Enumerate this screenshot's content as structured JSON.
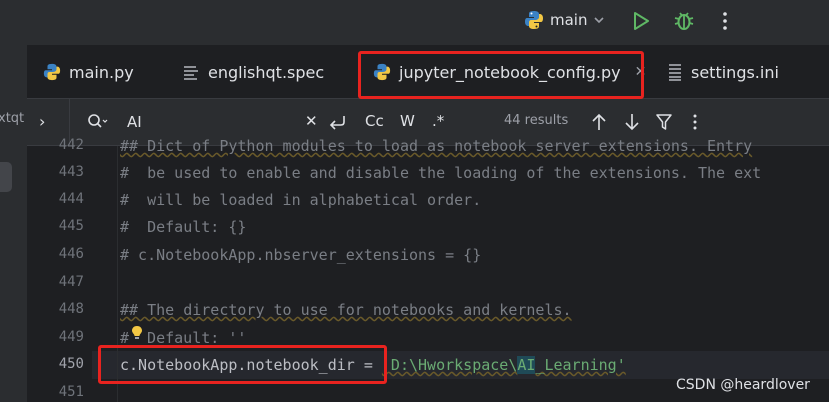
{
  "left_strip": {
    "clipped_label": "xtqt"
  },
  "toolbar": {
    "branch": "main"
  },
  "tabs": [
    {
      "label": "main.py",
      "icon": "python-icon"
    },
    {
      "label": "englishqt.spec",
      "icon": "text-lines-icon"
    },
    {
      "label": "jupyter_notebook_config.py",
      "icon": "python-icon",
      "active": true
    },
    {
      "label": "settings.ini",
      "icon": "ini-file-icon"
    }
  ],
  "search": {
    "query": "AI",
    "match_case_label": "Cc",
    "words_label": "W",
    "regex_label": ".*",
    "results": "44 results"
  },
  "editor": {
    "line_numbers": [
      "442",
      "443",
      "444",
      "445",
      "446",
      "447",
      "448",
      "449",
      "450",
      "451"
    ],
    "current_line": "450",
    "lines": {
      "l442": "## Dict of Python modules to load as notebook server extensions. Entry",
      "l443": "#  be used to enable and disable the loading of the extensions. The ext",
      "l444": "#  will be loaded in alphabetical order.",
      "l445": "#  Default: {}",
      "l446": "# c.NotebookApp.nbserver_extensions = {}",
      "l448": "## The directory to use for notebooks and kernels.",
      "l449a": "#",
      "l449b": " Default: ''",
      "l450_code": "c.NotebookApp.notebook_dir",
      "l450_eq": " = ",
      "l450_str_a": "'D:\\Hworkspace\\",
      "l450_str_match": "AI",
      "l450_str_b": "_Learning'"
    }
  },
  "watermark": "CSDN @heardlover",
  "colors": {
    "accent": "#3574f0",
    "highlight_box": "#e8231f",
    "run": "#5fb865",
    "debug": "#5fb865"
  }
}
